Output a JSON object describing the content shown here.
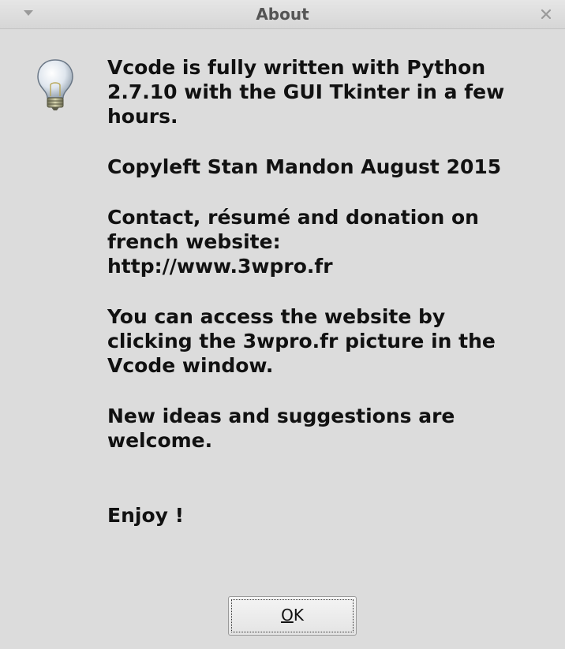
{
  "window": {
    "title": "About",
    "menu_icon": "chevron-down-icon",
    "close_icon": "close-icon"
  },
  "icon": {
    "name": "lightbulb-icon"
  },
  "message": {
    "p1": "Vcode is fully written with Python\n2.7.10 with the GUI Tkinter in a few\nhours.",
    "p2": "Copyleft Stan Mandon August 2015",
    "p3": "Contact, résumé and donation on\nfrench website:\nhttp://www.3wpro.fr",
    "p4": "You can access the website by\nclicking the 3wpro.fr picture in the\nVcode window.",
    "p5": "New ideas and suggestions are\nwelcome.",
    "p6": "Enjoy !"
  },
  "button": {
    "ok_mnemonic": "O",
    "ok_rest": "K"
  },
  "colors": {
    "background": "#dcdcdc",
    "title_text": "#555555",
    "body_text": "#111111"
  }
}
